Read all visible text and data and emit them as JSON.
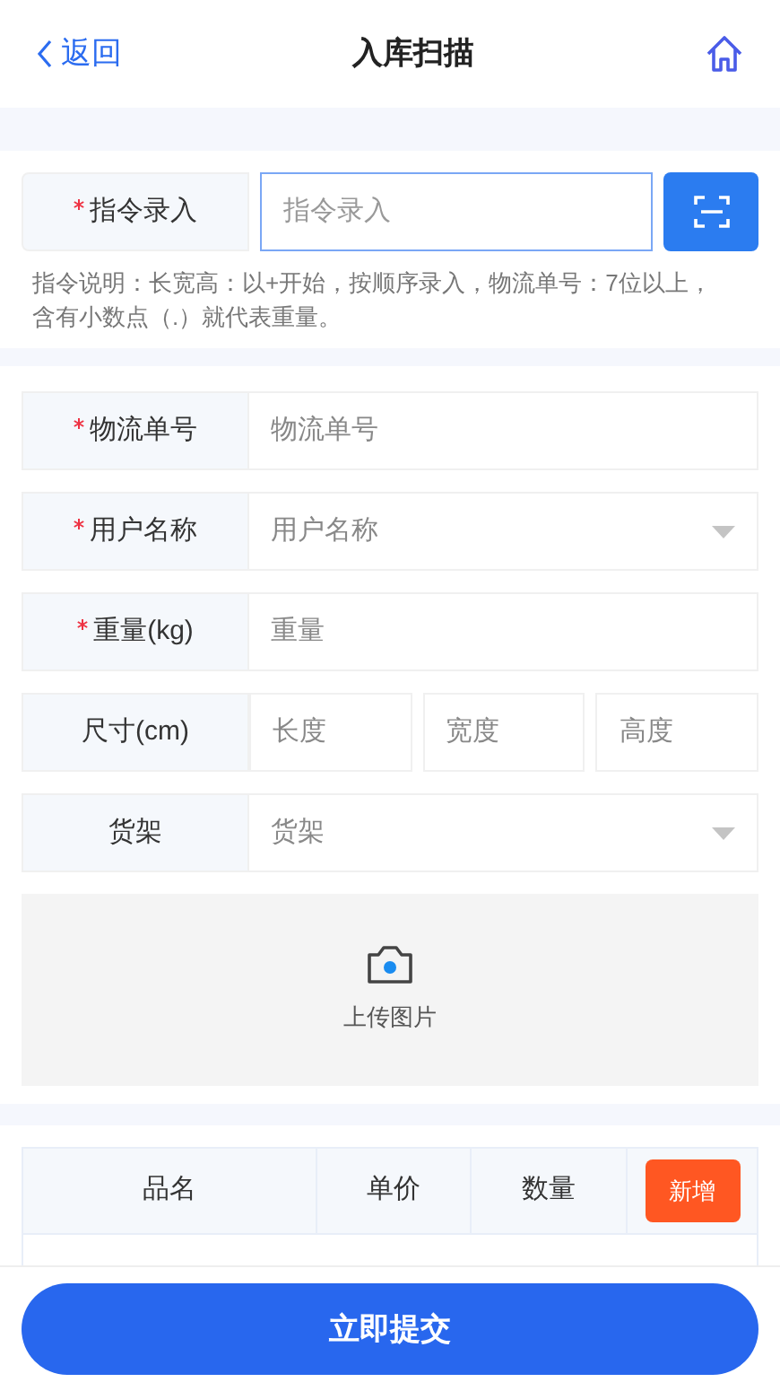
{
  "header": {
    "back": "返回",
    "title": "入库扫描"
  },
  "command": {
    "label": "指令录入",
    "required": true,
    "placeholder": "指令录入",
    "focused": true,
    "note": "指令说明：长宽高：以+开始，按顺序录入，物流单号：7位以上，含有小数点（.）就代表重量。"
  },
  "fields": [
    {
      "kind": "text",
      "label": "物流单号",
      "required": true,
      "placeholder": "物流单号"
    },
    {
      "kind": "select",
      "label": "用户名称",
      "required": true,
      "placeholder": "用户名称"
    },
    {
      "kind": "text",
      "label": "重量(kg)",
      "required": true,
      "placeholder": "重量"
    },
    {
      "kind": "dims",
      "label": "尺寸(cm)",
      "required": false,
      "placeholders": [
        "长度",
        "宽度",
        "高度"
      ]
    },
    {
      "kind": "select",
      "label": "货架",
      "required": false,
      "placeholder": "货架"
    }
  ],
  "upload": {
    "label": "上传图片"
  },
  "table": {
    "columns": [
      "品名",
      "单价",
      "数量"
    ],
    "add_button": "新增"
  },
  "submit": "立即提交"
}
